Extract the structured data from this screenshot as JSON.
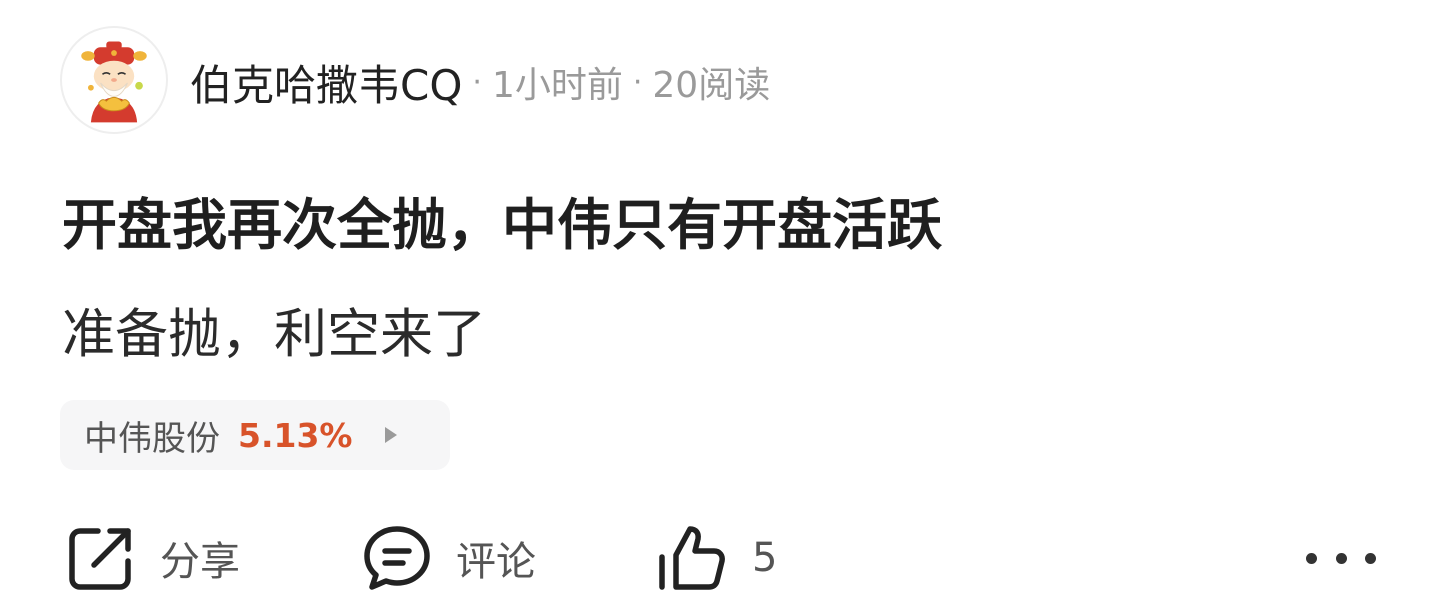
{
  "post": {
    "author": "伯克哈撒韦CQ",
    "separator": "·",
    "time": "1小时前",
    "reads": "20阅读",
    "title": "开盘我再次全抛，中伟只有开盘活跃",
    "content": "准备抛，利空来了"
  },
  "stock": {
    "name": "中伟股份",
    "change": "5.13%",
    "change_color": "#d8532a"
  },
  "actions": {
    "share_label": "分享",
    "comment_label": "评论",
    "like_count": "5"
  },
  "icons": {
    "avatar": "god-of-wealth-avatar",
    "share": "share-icon",
    "comment": "comment-icon",
    "like": "thumbs-up-icon",
    "more": "more-icon",
    "arrow": "triangle-right-icon"
  }
}
